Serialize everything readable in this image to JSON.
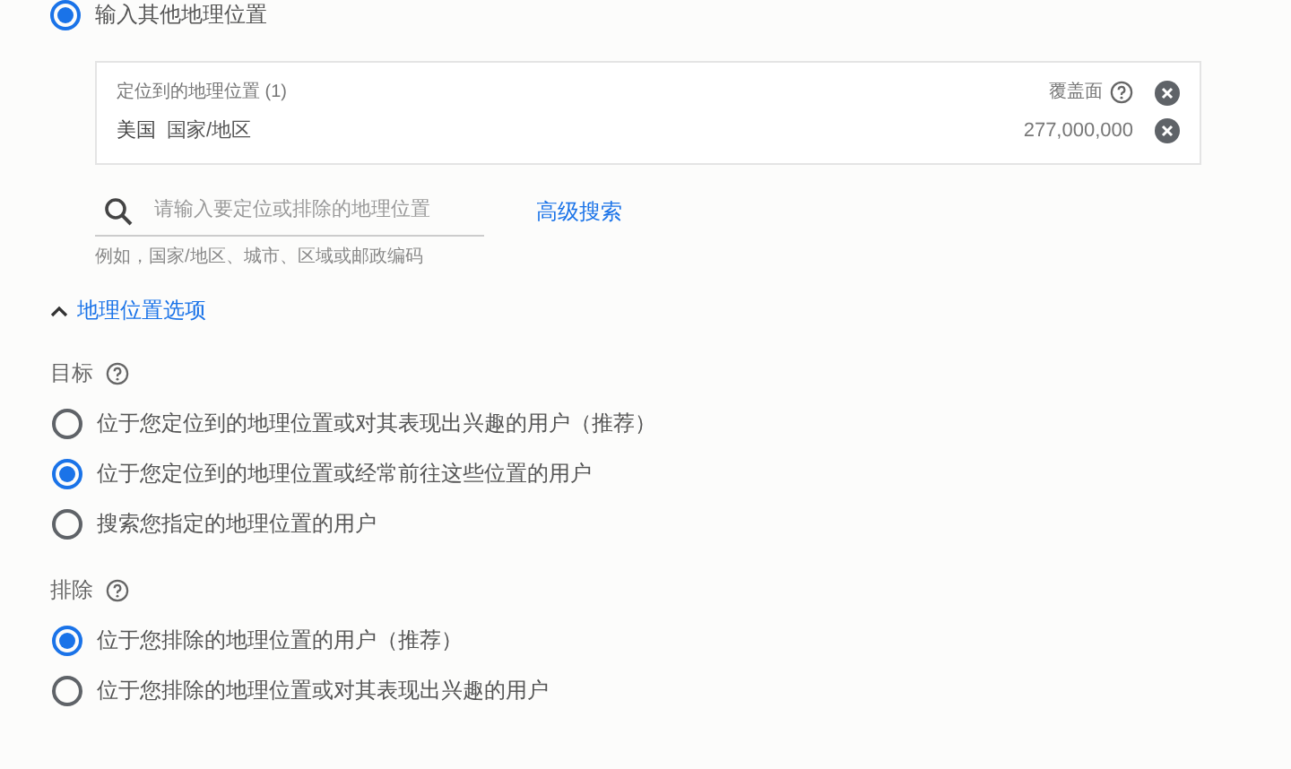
{
  "location_choice": {
    "label": "输入其他地理位置",
    "selected": true
  },
  "targeted_locations": {
    "title": "定位到的地理位置 (1)",
    "reach_label": "覆盖面",
    "rows": [
      {
        "name": "美国",
        "type": "国家/地区",
        "reach": "277,000,000"
      }
    ]
  },
  "search": {
    "placeholder": "请输入要定位或排除的地理位置",
    "hint": "例如，国家/地区、城市、区域或邮政编码",
    "advanced_link": "高级搜索"
  },
  "options_toggle": {
    "label": "地理位置选项",
    "expanded": true
  },
  "target": {
    "title": "目标",
    "options": [
      {
        "label": "位于您定位到的地理位置或对其表现出兴趣的用户（推荐）",
        "selected": false
      },
      {
        "label": "位于您定位到的地理位置或经常前往这些位置的用户",
        "selected": true
      },
      {
        "label": "搜索您指定的地理位置的用户",
        "selected": false
      }
    ]
  },
  "exclude": {
    "title": "排除",
    "options": [
      {
        "label": "位于您排除的地理位置的用户（推荐）",
        "selected": true
      },
      {
        "label": "位于您排除的地理位置或对其表现出兴趣的用户",
        "selected": false
      }
    ]
  }
}
